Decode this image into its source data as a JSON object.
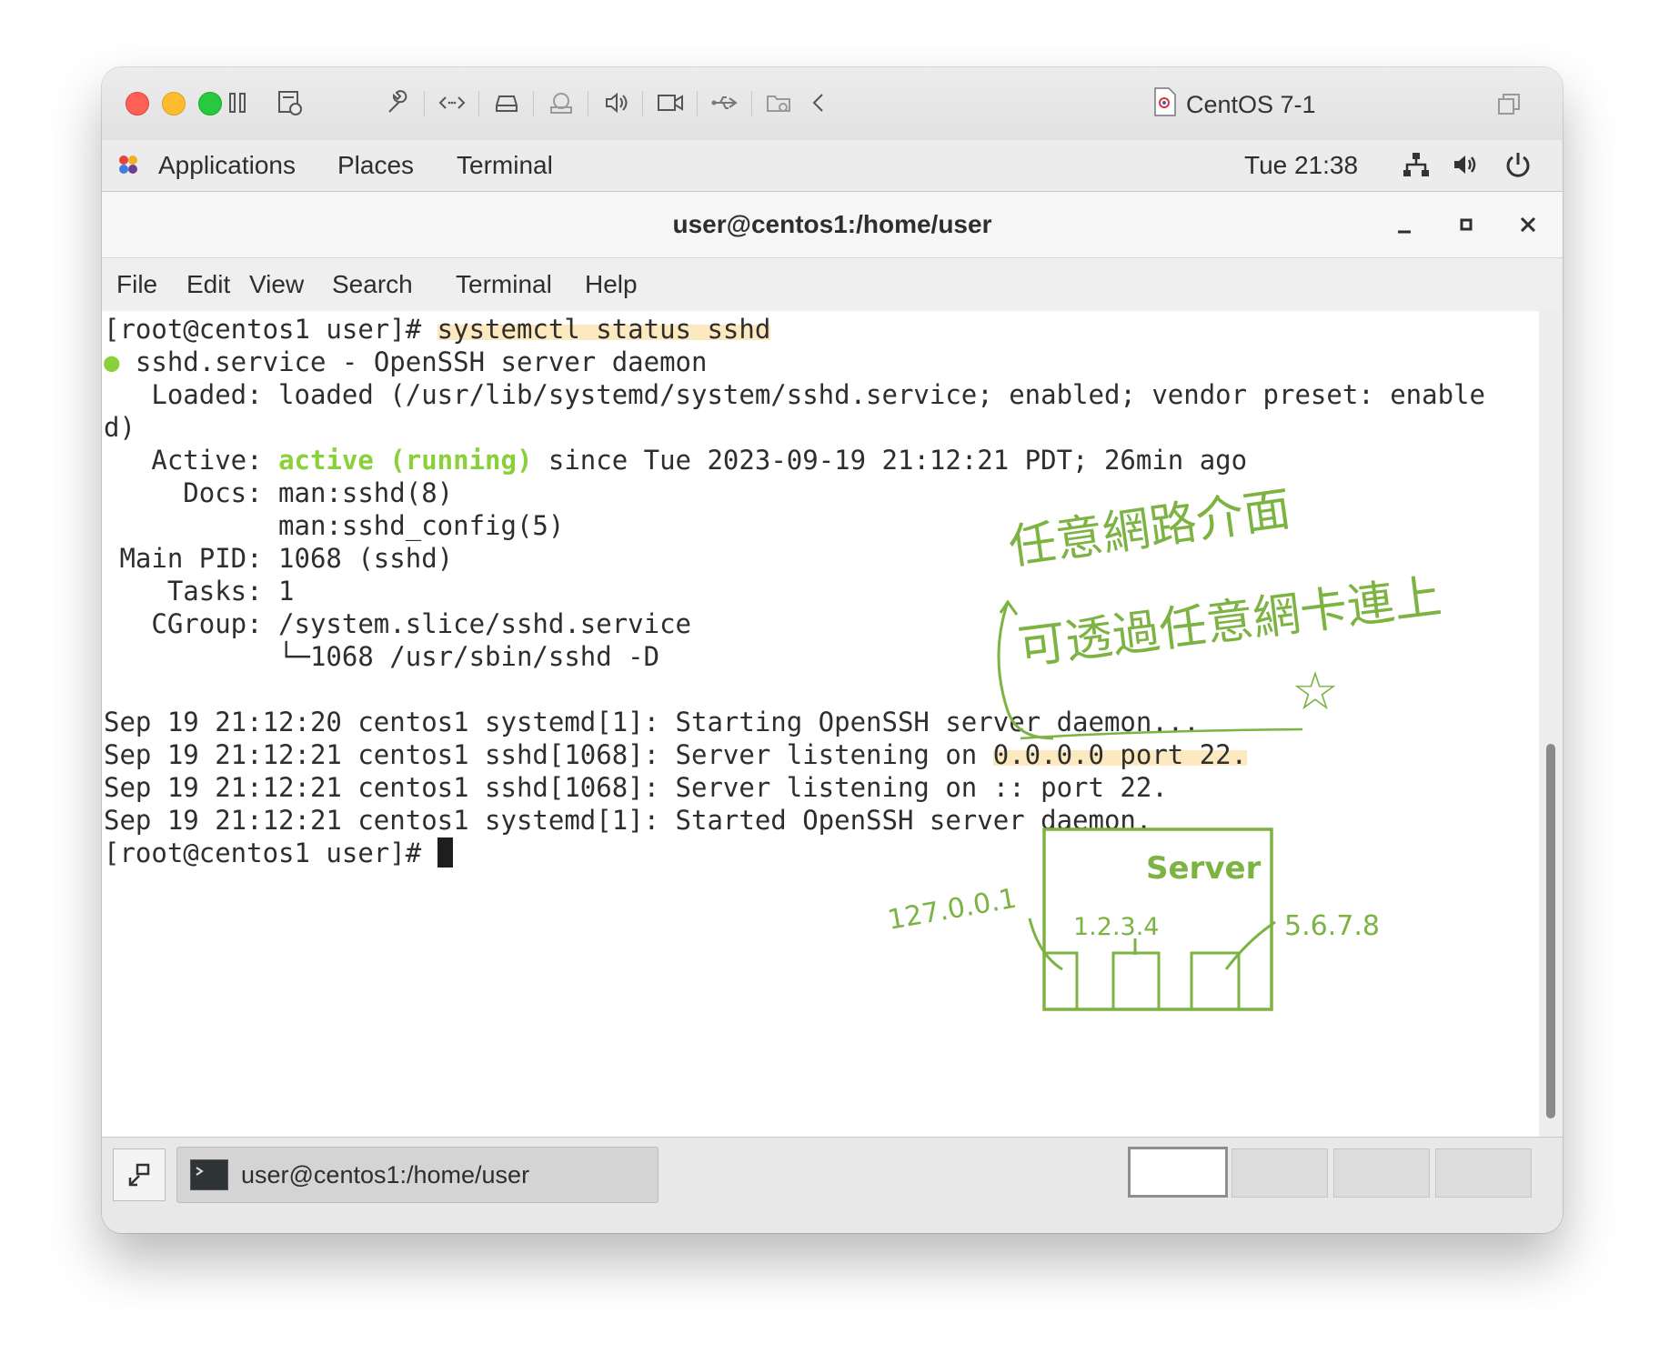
{
  "vm_window": {
    "title": "CentOS 7-1"
  },
  "gnome_bar": {
    "applications": "Applications",
    "places": "Places",
    "terminal": "Terminal",
    "clock": "Tue 21:38"
  },
  "terminal_window": {
    "title": "user@centos1:/home/user",
    "menu": [
      "File",
      "Edit",
      "View",
      "Search",
      "Terminal",
      "Help"
    ]
  },
  "terminal": {
    "prompt": "[root@centos1 user]# ",
    "command": "systemctl status sshd",
    "service_line": " sshd.service - OpenSSH server daemon",
    "loaded_line_1": "   Loaded: loaded (/usr/lib/systemd/system/sshd.service; enabled; vendor preset: enable",
    "loaded_line_2": "d)",
    "active_label": "   Active: ",
    "active_state": "active (running)",
    "active_since": " since Tue 2023-09-19 21:12:21 PDT; 26min ago",
    "docs_line_1": "     Docs: man:sshd(8)",
    "docs_line_2": "           man:sshd_config(5)",
    "main_pid": " Main PID: 1068 (sshd)",
    "tasks": "    Tasks: 1",
    "cgroup": "   CGroup: /system.slice/sshd.service",
    "cgroup_child": "           └─1068 /usr/sbin/sshd -D",
    "log_1": "Sep 19 21:12:20 centos1 systemd[1]: Starting OpenSSH server daemon...",
    "log_2_prefix": "Sep 19 21:12:21 centos1 sshd[1068]: Server listening on ",
    "log_2_highlight": "0.0.0.0 port 22.",
    "log_3": "Sep 19 21:12:21 centos1 sshd[1068]: Server listening on :: port 22.",
    "log_4": "Sep 19 21:12:21 centos1 systemd[1]: Started OpenSSH server daemon.",
    "final_prompt": "[root@centos1 user]# "
  },
  "annotations": {
    "note_line_1": "任意網路介面",
    "note_line_2": "可透過任意網卡連上",
    "star": "☆",
    "server_label": "Server",
    "ip_loopback": "127.0.0.1",
    "ip_a": "1.2.3.4",
    "ip_b": "5.6.7.8"
  },
  "taskbar": {
    "task_label": "user@centos1:/home/user"
  },
  "colors": {
    "active_green": "#8ad03a",
    "annotation_green": "#7cb342",
    "highlight_yellow": "#fad78c"
  }
}
